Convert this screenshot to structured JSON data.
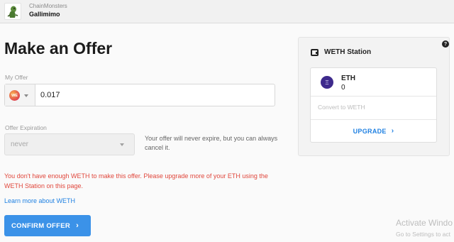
{
  "header": {
    "collection_name": "ChainMonsters",
    "item_name": "Gallimimo"
  },
  "page_title": "Make an Offer",
  "offer": {
    "label": "My Offer",
    "token_symbol": "WETH",
    "token_abbrev": "WE",
    "amount": "0.017"
  },
  "expiration": {
    "label": "Offer Expiration",
    "selected": "never",
    "note": "Your offer will never expire, but you can always cancel it."
  },
  "error_message": "You don't have enough WETH to make this offer. Please upgrade more of your ETH using the WETH Station on this page.",
  "learn_more_link": "Learn more about WETH",
  "confirm_button": "CONFIRM OFFER",
  "weth_station": {
    "title": "WETH Station",
    "token": "ETH",
    "balance": "0",
    "convert_placeholder": "Convert to WETH",
    "upgrade_button": "UPGRADE"
  },
  "windows_watermark": {
    "title": "Activate Windo",
    "subtitle": "Go to Settings to act"
  },
  "colors": {
    "primary": "#3b92e8",
    "link": "#2081e2",
    "error": "#e0473c",
    "eth_icon": "#3e2a8c"
  },
  "icons": {
    "thumbnail": "monster-thumbnail",
    "token": "weth-token-icon",
    "wallet": "wallet-icon",
    "help": "help-icon",
    "eth": "eth-icon",
    "chevron": "chevron-right-icon"
  }
}
